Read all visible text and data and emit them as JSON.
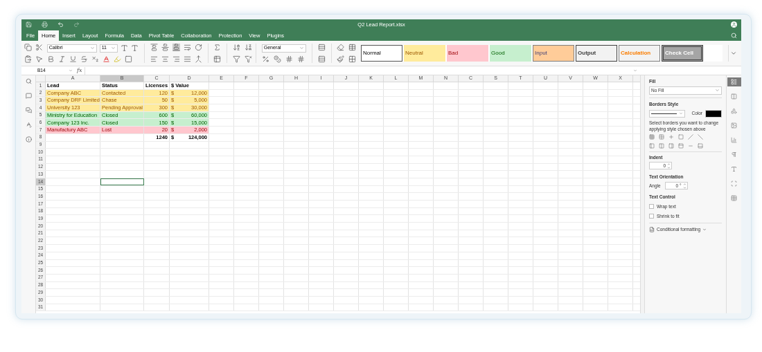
{
  "window": {
    "title": "Q2 Lead Report.xlsx"
  },
  "menu_tabs": [
    {
      "label": "File",
      "selected": false
    },
    {
      "label": "Home",
      "selected": true
    },
    {
      "label": "Insert",
      "selected": false
    },
    {
      "label": "Layout",
      "selected": false
    },
    {
      "label": "Formula",
      "selected": false
    },
    {
      "label": "Data",
      "selected": false
    },
    {
      "label": "Pivot Table",
      "selected": false
    },
    {
      "label": "Collaboration",
      "selected": false
    },
    {
      "label": "Protection",
      "selected": false
    },
    {
      "label": "View",
      "selected": false
    },
    {
      "label": "Plugins",
      "selected": false
    }
  ],
  "toolbar": {
    "font": "Calibri",
    "font_size": "11",
    "number_format": "General"
  },
  "cell_styles": [
    {
      "label": "Normal",
      "kind": "normal"
    },
    {
      "label": "Neutral",
      "kind": "neutral"
    },
    {
      "label": "Bad",
      "kind": "bad"
    },
    {
      "label": "Good",
      "kind": "good"
    },
    {
      "label": "Input",
      "kind": "input"
    },
    {
      "label": "Output",
      "kind": "output"
    },
    {
      "label": "Calculation",
      "kind": "calculation"
    },
    {
      "label": "Check Cell",
      "kind": "check"
    }
  ],
  "formula_bar": {
    "cell_ref": "B14",
    "function_label": "fx"
  },
  "sheet": {
    "columns": [
      {
        "label": "A",
        "selected": false
      },
      {
        "label": "B",
        "selected": true
      },
      {
        "label": "C",
        "selected": false
      },
      {
        "label": "D",
        "selected": false
      },
      {
        "label": "E",
        "selected": false
      },
      {
        "label": "F",
        "selected": false
      },
      {
        "label": "G",
        "selected": false
      },
      {
        "label": "H",
        "selected": false
      },
      {
        "label": "I",
        "selected": false
      },
      {
        "label": "J",
        "selected": false
      },
      {
        "label": "K",
        "selected": false
      },
      {
        "label": "L",
        "selected": false
      },
      {
        "label": "M",
        "selected": false
      },
      {
        "label": "N",
        "selected": false
      },
      {
        "label": "C",
        "selected": false
      },
      {
        "label": "S",
        "selected": false
      },
      {
        "label": "T",
        "selected": false
      },
      {
        "label": "U",
        "selected": false
      },
      {
        "label": "V",
        "selected": false
      },
      {
        "label": "W",
        "selected": false
      },
      {
        "label": "X",
        "selected": false
      }
    ],
    "rows": [
      {
        "number": "1",
        "selected": false,
        "kind": "header",
        "lead": "Lead",
        "status": "Status",
        "licenses": "Licenses",
        "value": "$ Value"
      },
      {
        "number": "2",
        "selected": false,
        "kind": "neutral",
        "lead": "Company ABC",
        "status": "Contacted",
        "licenses": "120",
        "currency": "$",
        "value": "12,000"
      },
      {
        "number": "3",
        "selected": false,
        "kind": "neutral",
        "lead": "Company DRF Limited",
        "status": "Chase",
        "licenses": "50",
        "currency": "$",
        "value": "5,000"
      },
      {
        "number": "4",
        "selected": false,
        "kind": "neutral",
        "lead": "University 123",
        "status": "Pending Approval",
        "licenses": "300",
        "currency": "$",
        "value": "30,000"
      },
      {
        "number": "5",
        "selected": false,
        "kind": "good",
        "lead": "Ministry for Education",
        "status": "Closed",
        "licenses": "600",
        "currency": "$",
        "value": "60,000"
      },
      {
        "number": "6",
        "selected": false,
        "kind": "good",
        "lead": "Company 123 Inc.",
        "status": "Closed",
        "licenses": "150",
        "currency": "$",
        "value": "15,000"
      },
      {
        "number": "7",
        "selected": false,
        "kind": "bad",
        "lead": "Manufactury ABC",
        "status": "Lost",
        "licenses": "20",
        "currency": "$",
        "value": "2,000"
      },
      {
        "number": "8",
        "selected": false,
        "kind": "total",
        "licenses": "1240",
        "currency": "$",
        "value": "124,000"
      },
      {
        "number": "9",
        "selected": false
      },
      {
        "number": "10",
        "selected": false
      },
      {
        "number": "11",
        "selected": false
      },
      {
        "number": "12",
        "selected": false
      },
      {
        "number": "13",
        "selected": false
      },
      {
        "number": "14",
        "selected": true
      },
      {
        "number": "15",
        "selected": false
      },
      {
        "number": "16",
        "selected": false
      },
      {
        "number": "17",
        "selected": false
      },
      {
        "number": "18",
        "selected": false
      },
      {
        "number": "19",
        "selected": false
      },
      {
        "number": "20",
        "selected": false
      },
      {
        "number": "21",
        "selected": false
      },
      {
        "number": "22",
        "selected": false
      },
      {
        "number": "23",
        "selected": false
      },
      {
        "number": "24",
        "selected": false
      },
      {
        "number": "25",
        "selected": false
      },
      {
        "number": "26",
        "selected": false
      },
      {
        "number": "27",
        "selected": false
      },
      {
        "number": "28",
        "selected": false
      },
      {
        "number": "29",
        "selected": false
      },
      {
        "number": "30",
        "selected": false
      },
      {
        "number": "31",
        "selected": false
      }
    ]
  },
  "panel": {
    "fill_label": "Fill",
    "fill_value": "No Fill",
    "borders_label": "Borders Style",
    "color_label": "Color",
    "borders_hint": "Select borders you want to change applying style chosen above",
    "indent_label": "Indent",
    "indent_value": "0",
    "orientation_label": "Text Orientation",
    "angle_label": "Angle",
    "angle_value": "0 °",
    "text_control_label": "Text Control",
    "options": [
      {
        "label": "Wrap text",
        "checked": false
      },
      {
        "label": "Shrink to fit",
        "checked": false
      }
    ],
    "conditional_formatting": "Conditional formatting"
  },
  "right_sidebar": [
    {
      "selected": true
    },
    {
      "selected": false
    },
    {
      "selected": false
    },
    {
      "selected": false
    },
    {
      "selected": false
    },
    {
      "selected": false
    },
    {
      "selected": false
    },
    {
      "selected": false
    },
    {
      "selected": false
    }
  ]
}
